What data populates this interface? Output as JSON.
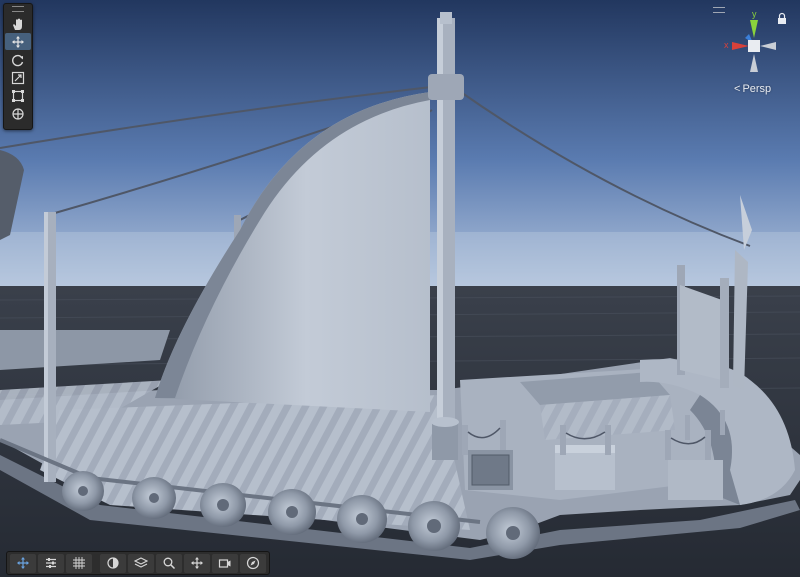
{
  "window": {
    "view_mode_label": "Persp"
  },
  "gizmo": {
    "axis_x_label": "x",
    "axis_y_label": "y",
    "axis_x_color": "#d9413a",
    "axis_y_color": "#8ad33c",
    "axis_z_color": "#3b7fd9"
  },
  "tools": [
    {
      "name": "hand-tool",
      "icon": "hand-icon",
      "active": false
    },
    {
      "name": "move-tool",
      "icon": "move-arrows-icon",
      "active": true
    },
    {
      "name": "rotate-tool",
      "icon": "rotate-icon",
      "active": false
    },
    {
      "name": "scale-tool",
      "icon": "scale-icon",
      "active": false
    },
    {
      "name": "rect-tool",
      "icon": "rect-transform-icon",
      "active": false
    },
    {
      "name": "transform-tool",
      "icon": "transform-icon",
      "active": false
    }
  ],
  "bottom_tools": [
    {
      "name": "move-handle",
      "icon": "move-arrows-icon"
    },
    {
      "name": "sliders",
      "icon": "sliders-icon"
    },
    {
      "name": "grid-snap",
      "icon": "grid-snap-icon"
    },
    {
      "name": "shading-mode",
      "icon": "half-circle-icon"
    },
    {
      "name": "layers",
      "icon": "layers-icon"
    },
    {
      "name": "search",
      "icon": "search-icon"
    },
    {
      "name": "pivot-handle",
      "icon": "move-arrows-icon"
    },
    {
      "name": "camera",
      "icon": "camera-icon"
    },
    {
      "name": "compass",
      "icon": "compass-icon"
    }
  ],
  "colors": {
    "sky_top": "#233a68",
    "sky_horizon": "#9bb3d6",
    "sea": "#2b3039",
    "model": "#b3bcca",
    "model_shadow": "#7e8898",
    "rope": "#4f5767",
    "toolbar_bg": "#2b2b2b",
    "active_tool": "#46607c"
  }
}
